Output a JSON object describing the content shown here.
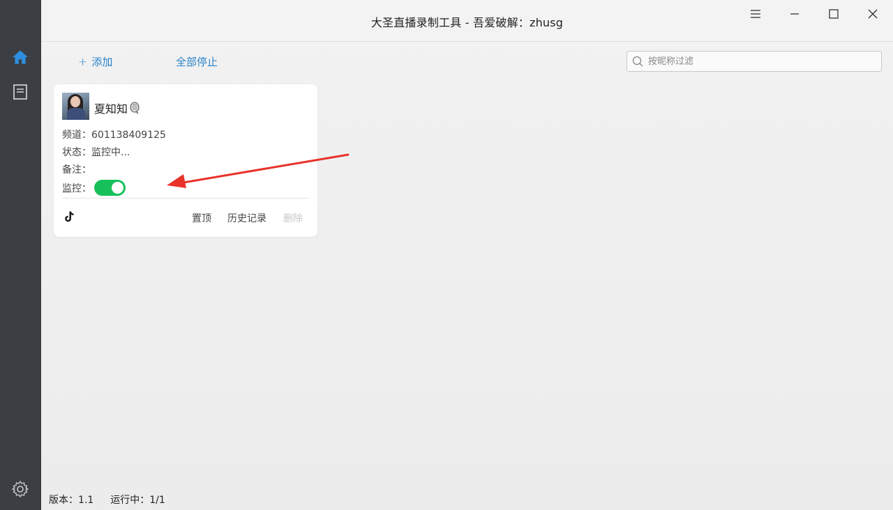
{
  "window": {
    "title": "大圣直播录制工具 - 吾爱破解：zhusg"
  },
  "sidebar": {
    "items": [
      {
        "icon": "home-icon",
        "active": true
      },
      {
        "icon": "document-icon",
        "active": false
      },
      {
        "icon": "gear-icon",
        "active": false
      }
    ]
  },
  "toolbar": {
    "add_label": "添加",
    "stop_all_label": "全部停止",
    "search_placeholder": "按昵称过滤",
    "search_value": ""
  },
  "card": {
    "name": "夏知知",
    "channel_label": "频道：",
    "channel_value": "601138409125",
    "status_label": "状态：",
    "status_value": "监控中...",
    "note_label": "备注：",
    "note_value": "",
    "monitor_label": "监控：",
    "monitor_on": true,
    "platform_icon": "tiktok-icon",
    "actions": {
      "pin": "置顶",
      "history": "历史记录",
      "delete": "删除"
    }
  },
  "statusbar": {
    "version": "版本：1.1",
    "running": "运行中：1/1"
  },
  "colors": {
    "accent": "#2a83c9",
    "toggle_on": "#16c15a",
    "sidebar_bg": "#3b3e42",
    "annotation_arrow": "#e8322a"
  }
}
